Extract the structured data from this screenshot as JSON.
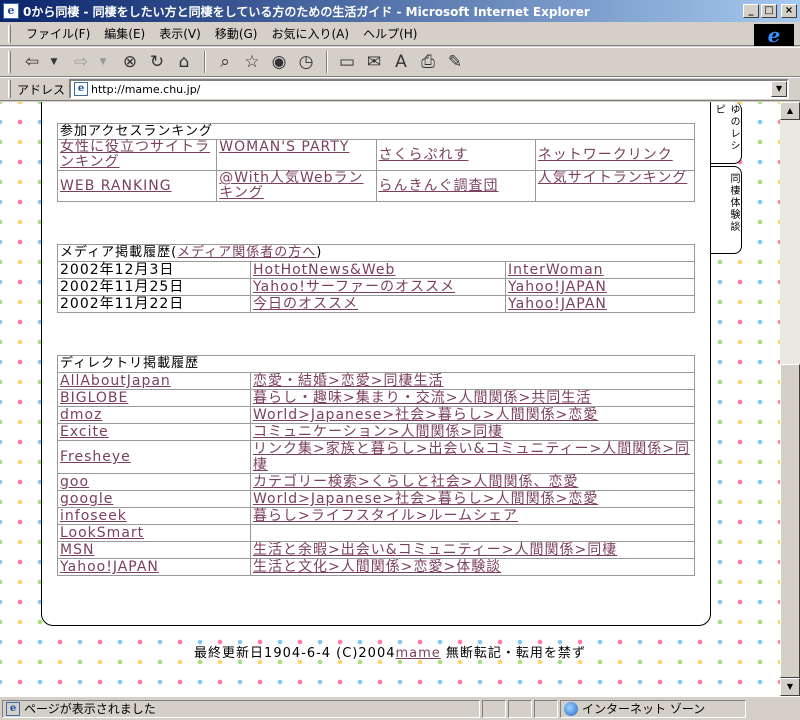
{
  "window": {
    "title": "0から同棲 - 同棲をしたい方と同棲をしている方のための生活ガイド - Microsoft Internet Explorer"
  },
  "menu": [
    "ファイル(F)",
    "編集(E)",
    "表示(V)",
    "移動(G)",
    "お気に入り(A)",
    "ヘルプ(H)"
  ],
  "address": {
    "label": "アドレス",
    "url": "http://mame.chu.jp/"
  },
  "tabs": {
    "recipe": "ゆのレシピ",
    "experience": "同棲体験談"
  },
  "rankings": {
    "heading": "参加アクセスランキング",
    "links": [
      "女性に役立つサイトランキング",
      "WOMAN'S PARTY",
      "さくらぷれす",
      "ネットワークリンク",
      "WEB RANKING",
      "@With人気Webランキング",
      "らんきんぐ調査団",
      "人気サイトランキング"
    ]
  },
  "media": {
    "heading_prefix": "メディア掲載履歴(",
    "heading_link": "メディア関係者の方へ",
    "heading_suffix": ")",
    "rows": [
      {
        "date": "2002年12月3日",
        "item": "HotHotNews&Web",
        "site": "InterWoman"
      },
      {
        "date": "2002年11月25日",
        "item": "Yahoo!サーファーのオススメ",
        "site": "Yahoo!JAPAN"
      },
      {
        "date": "2002年11月22日",
        "item": "今日のオススメ",
        "site": "Yahoo!JAPAN"
      }
    ]
  },
  "directory": {
    "heading": "ディレクトリ掲載履歴",
    "rows": [
      {
        "name": "AllAboutJapan",
        "path": "恋愛・結婚>恋愛>同棲生活"
      },
      {
        "name": "BIGLOBE",
        "path": "暮らし・趣味>集まり・交流>人間関係>共同生活"
      },
      {
        "name": "dmoz",
        "path": "World>Japanese>社会>暮らし>人間関係>恋愛"
      },
      {
        "name": "Excite",
        "path": "コミュニケーション>人間関係>同棲"
      },
      {
        "name": "Fresheye",
        "path": "リンク集>家族と暮らし>出会い&コミュニティー>人間関係>同棲"
      },
      {
        "name": "goo",
        "path": "カテゴリー検索>くらしと社会>人間関係、恋愛"
      },
      {
        "name": "google",
        "path": "World>Japanese>社会>暮らし>人間関係>恋愛"
      },
      {
        "name": "infoseek",
        "path": "暮らし>ライフスタイル>ルームシェア"
      },
      {
        "name": "LookSmart",
        "path": ""
      },
      {
        "name": "MSN",
        "path": "生活と余暇>出会い&コミュニティー>人間関係>同棲"
      },
      {
        "name": "Yahoo!JAPAN",
        "path": "生活と文化>人間関係>恋愛>体験談"
      }
    ]
  },
  "footer": {
    "prefix": "最終更新日1904-6-4 (C)2004",
    "author": "mame",
    "suffix": " 無断転記・転用を禁ず"
  },
  "status": {
    "message": "ページが表示されました",
    "zone": "インターネット ゾーン"
  }
}
